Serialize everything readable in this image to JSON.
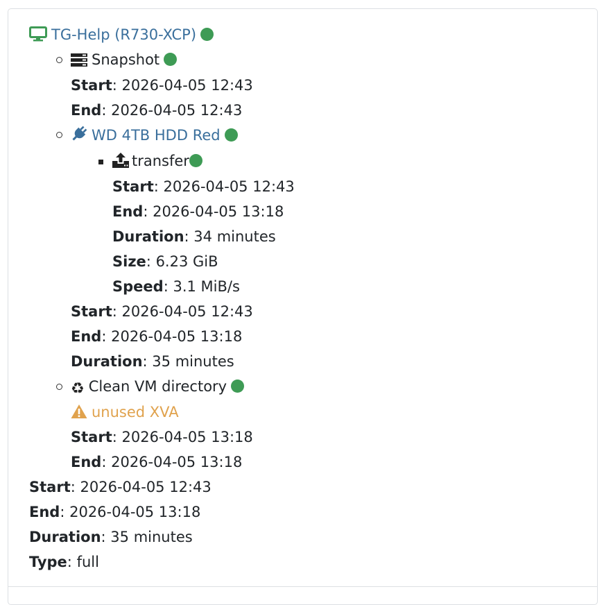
{
  "vm": {
    "name": "TG-Help (R730-XCP)",
    "status_color": "#3e9b55",
    "tasks": [
      {
        "icon": "server-icon",
        "title": "Snapshot",
        "start_label": "Start",
        "start": "2026-04-05 12:43",
        "end_label": "End",
        "end": "2026-04-05 12:43"
      },
      {
        "icon": "plug-icon",
        "title": "WD 4TB HDD Red",
        "subtask": {
          "icon": "upload-icon",
          "title": "transfer",
          "start_label": "Start",
          "start": "2026-04-05 12:43",
          "end_label": "End",
          "end": "2026-04-05 13:18",
          "duration_label": "Duration",
          "duration": "34 minutes",
          "size_label": "Size",
          "size": "6.23 GiB",
          "speed_label": "Speed",
          "speed": "3.1 MiB/s"
        },
        "start_label": "Start",
        "start": "2026-04-05 12:43",
        "end_label": "End",
        "end": "2026-04-05 13:18",
        "duration_label": "Duration",
        "duration": "35 minutes"
      },
      {
        "icon": "recycle-icon",
        "title": "Clean VM directory",
        "warning": "unused XVA",
        "start_label": "Start",
        "start": "2026-04-05 13:18",
        "end_label": "End",
        "end": "2026-04-05 13:18"
      }
    ],
    "start_label": "Start",
    "start": "2026-04-05 12:43",
    "end_label": "End",
    "end": "2026-04-05 13:18",
    "duration_label": "Duration",
    "duration": "35 minutes",
    "type_label": "Type",
    "type": "full"
  },
  "colors": {
    "link": "#3a6f9c",
    "warning": "#e0a24d",
    "success": "#3e9b55"
  }
}
